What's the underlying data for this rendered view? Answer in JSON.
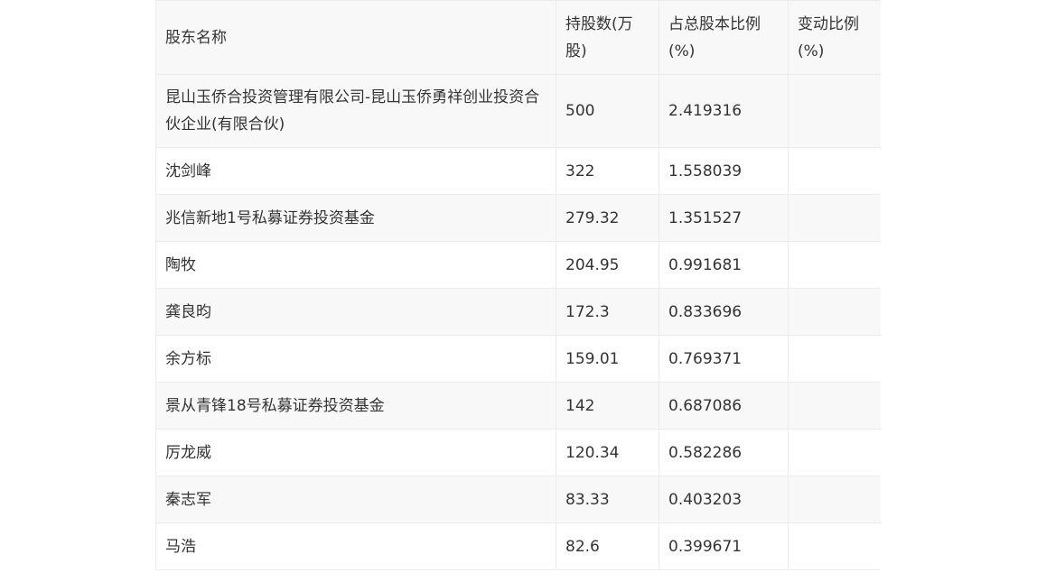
{
  "table": {
    "headers": [
      "股东名称",
      "持股数(万股)",
      "占总股本比例(%)",
      "变动比例(%)"
    ],
    "rows": [
      {
        "name": "昆山玉侨合投资管理有限公司-昆山玉侨勇祥创业投资合伙企业(有限合伙)",
        "shares": "500",
        "ratio": "2.419316",
        "change": ""
      },
      {
        "name": "沈剑峰",
        "shares": "322",
        "ratio": "1.558039",
        "change": ""
      },
      {
        "name": "兆信新地1号私募证券投资基金",
        "shares": "279.32",
        "ratio": "1.351527",
        "change": ""
      },
      {
        "name": "陶牧",
        "shares": "204.95",
        "ratio": "0.991681",
        "change": ""
      },
      {
        "name": "龚良昀",
        "shares": "172.3",
        "ratio": "0.833696",
        "change": ""
      },
      {
        "name": "余方标",
        "shares": "159.01",
        "ratio": "0.769371",
        "change": ""
      },
      {
        "name": "景从青锋18号私募证券投资基金",
        "shares": "142",
        "ratio": "0.687086",
        "change": ""
      },
      {
        "name": "厉龙威",
        "shares": "120.34",
        "ratio": "0.582286",
        "change": ""
      },
      {
        "name": "秦志军",
        "shares": "83.33",
        "ratio": "0.403203",
        "change": ""
      },
      {
        "name": "马浩",
        "shares": "82.6",
        "ratio": "0.399671",
        "change": ""
      }
    ]
  }
}
